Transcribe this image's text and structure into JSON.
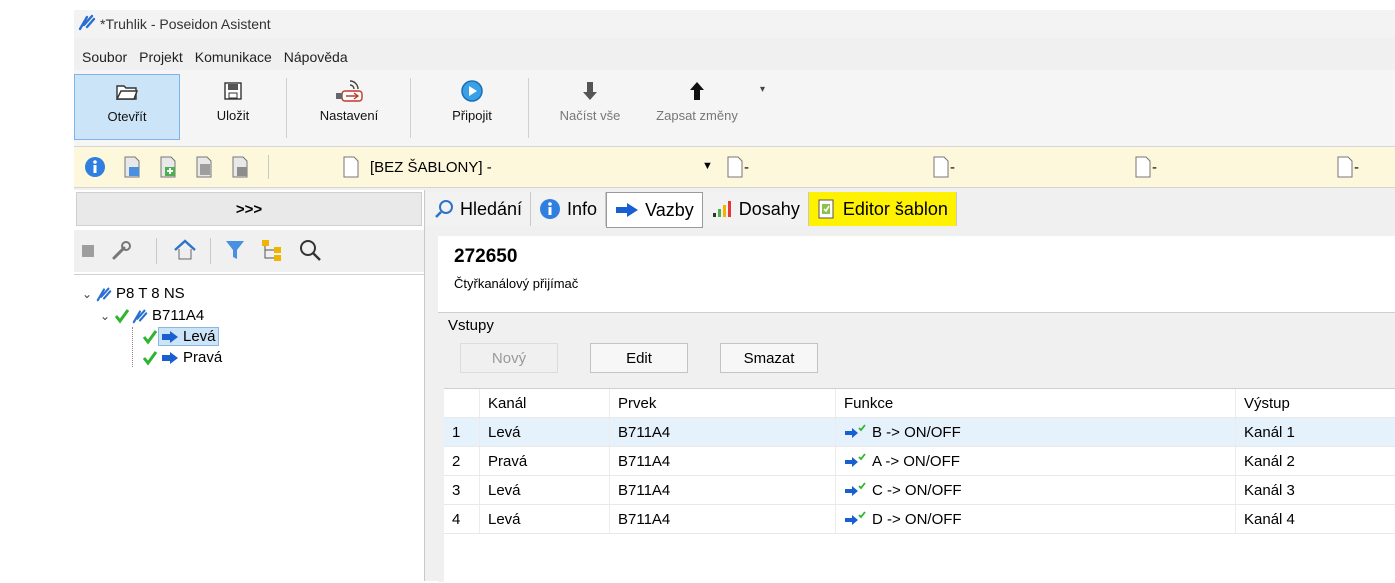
{
  "window": {
    "title": "*Truhlik - Poseidon Asistent"
  },
  "menu": [
    "Soubor",
    "Projekt",
    "Komunikace",
    "Nápověda"
  ],
  "ribbon": {
    "open": "Otevřít",
    "save": "Uložit",
    "settings": "Nastavení",
    "connect": "Připojit",
    "load_all": "Načíst vše",
    "write_changes": "Zapsat změny"
  },
  "template_bar": {
    "template_select": "[BEZ ŠABLONY] -",
    "slots": [
      "-",
      "-",
      "-",
      "-"
    ]
  },
  "left_panel": {
    "header": ">>>",
    "tree": {
      "root": "P8 T 8 NS",
      "device": "B711A4",
      "channels": [
        "Levá",
        "Pravá"
      ]
    }
  },
  "tabs": [
    "Hledání",
    "Info",
    "Vazby",
    "Dosahy",
    "Editor šablon"
  ],
  "device": {
    "id": "272650",
    "description": "Čtyřkanálový přijímač"
  },
  "inputs": {
    "title": "Vstupy",
    "buttons": {
      "new": "Nový",
      "edit": "Edit",
      "delete": "Smazat"
    },
    "columns": [
      "",
      "Kanál",
      "Prvek",
      "Funkce",
      "Výstup"
    ],
    "rows": [
      [
        "1",
        "Levá",
        "B711A4",
        "B -> ON/OFF",
        "Kanál 1"
      ],
      [
        "2",
        "Pravá",
        "B711A4",
        "A -> ON/OFF",
        "Kanál 2"
      ],
      [
        "3",
        "Levá",
        "B711A4",
        "C -> ON/OFF",
        "Kanál 3"
      ],
      [
        "4",
        "Levá",
        "B711A4",
        "D -> ON/OFF",
        "Kanál 4"
      ]
    ]
  },
  "colors": {
    "highlight_tab": "#fff200",
    "selected_row": "#e5f1fb",
    "ribbon_active": "#cce4f7",
    "arrow_blue": "#1a5fd1",
    "check_green": "#2db52d"
  }
}
